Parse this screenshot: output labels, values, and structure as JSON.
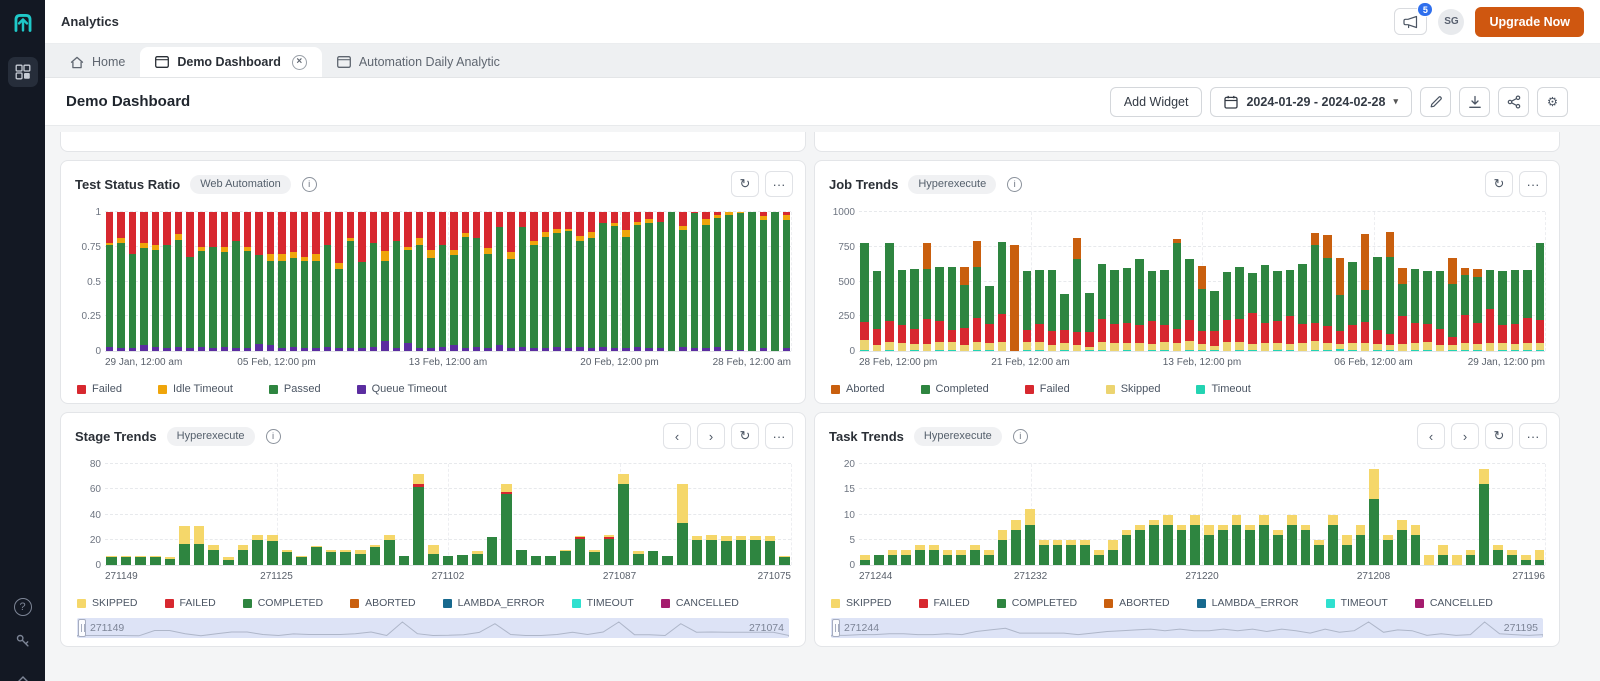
{
  "ui_colors": {
    "accent_orange": "#cf5710",
    "badge_blue": "#2f6fed",
    "sidebar_bg": "#131823",
    "logo_teal": "#1fc8c8",
    "card_border": "#e3e5e8",
    "brush_bg": "#dde3f6"
  },
  "icons": {
    "refresh": "↻",
    "more": "···",
    "prev": "‹",
    "next": "›",
    "caret_down": "▾",
    "close": "×",
    "gear": "⚙",
    "info": "i",
    "help": "?"
  },
  "topbar": {
    "title": "Analytics",
    "notification_count": "5",
    "avatar_initials": "SG",
    "upgrade_label": "Upgrade Now"
  },
  "tabs": [
    {
      "label": "Home"
    },
    {
      "label": "Demo Dashboard"
    },
    {
      "label": "Automation Daily Analytic"
    }
  ],
  "page_header": {
    "title": "Demo Dashboard",
    "add_widget_label": "Add Widget",
    "date_range": "2024-01-29 - 2024-02-28"
  },
  "chart_data": [
    {
      "type": "bar",
      "widget_title": "Test Status Ratio",
      "badge": "Web Automation",
      "ylim": [
        0,
        1
      ],
      "y_ticks": [
        0,
        0.25,
        0.5,
        0.75,
        1
      ],
      "x_ticks": [
        "29 Jan, 12:00 am",
        "05 Feb, 12:00 pm",
        "13 Feb, 12:00 am",
        "20 Feb, 12:00 pm",
        "28 Feb, 12:00 am"
      ],
      "stack": [
        "Queue Timeout",
        "Passed",
        "Idle Timeout",
        "Failed"
      ],
      "series": [
        {
          "name": "Failed",
          "color": "#d7282f",
          "values": [
            0.22,
            0.19,
            0.3,
            0.22,
            0.24,
            0.24,
            0.16,
            0.32,
            0.25,
            0.25,
            0.25,
            0.21,
            0.25,
            0.31,
            0.3,
            0.3,
            0.29,
            0.32,
            0.3,
            0.24,
            0.37,
            0.19,
            0.36,
            0.22,
            0.28,
            0.21,
            0.25,
            0.19,
            0.27,
            0.24,
            0.27,
            0.15,
            0.19,
            0.26,
            0.11,
            0.29,
            0.11,
            0.21,
            0.14,
            0.12,
            0.12,
            0.17,
            0.14,
            0.08,
            0.08,
            0.13,
            0.07,
            0.05,
            0.07,
            0,
            0.1,
            0.01,
            0.05,
            0.02,
            0,
            0,
            0,
            0.03,
            0,
            0.02
          ]
        },
        {
          "name": "Idle Timeout",
          "color": "#efa50b",
          "values": [
            0.02,
            0.03,
            0,
            0.04,
            0.03,
            0,
            0.04,
            0,
            0.03,
            0,
            0.04,
            0,
            0.03,
            0,
            0.05,
            0.05,
            0.04,
            0.03,
            0.05,
            0,
            0.04,
            0.02,
            0,
            0,
            0.07,
            0,
            0.02,
            0.05,
            0.06,
            0,
            0.04,
            0.03,
            0,
            0.04,
            0,
            0.05,
            0,
            0.03,
            0.04,
            0.03,
            0.02,
            0.04,
            0.05,
            0,
            0.02,
            0.05,
            0.02,
            0.03,
            0,
            0,
            0.03,
            0,
            0.04,
            0.02,
            0.02,
            0.01,
            0,
            0.03,
            0,
            0.04
          ]
        },
        {
          "name": "Passed",
          "color": "#2e8540",
          "values": [
            0.73,
            0.76,
            0.68,
            0.7,
            0.7,
            0.74,
            0.77,
            0.66,
            0.69,
            0.73,
            0.68,
            0.77,
            0.7,
            0.64,
            0.61,
            0.63,
            0.64,
            0.63,
            0.63,
            0.73,
            0.57,
            0.77,
            0.62,
            0.75,
            0.58,
            0.77,
            0.67,
            0.74,
            0.65,
            0.73,
            0.65,
            0.8,
            0.78,
            0.68,
            0.85,
            0.64,
            0.86,
            0.74,
            0.8,
            0.82,
            0.84,
            0.76,
            0.79,
            0.89,
            0.88,
            0.8,
            0.88,
            0.9,
            0.91,
            1.0,
            0.84,
            0.97,
            0.89,
            0.93,
            0.97,
            0.98,
            1.0,
            0.92,
            1.0,
            0.92
          ]
        },
        {
          "name": "Queue Timeout",
          "color": "#5b2da0",
          "values": [
            0.03,
            0.02,
            0.02,
            0.04,
            0.03,
            0.02,
            0.03,
            0.02,
            0.03,
            0.02,
            0.03,
            0.02,
            0.02,
            0.05,
            0.04,
            0.02,
            0.03,
            0.02,
            0.02,
            0.03,
            0.02,
            0.02,
            0.02,
            0.03,
            0.07,
            0.02,
            0.06,
            0.02,
            0.02,
            0.03,
            0.04,
            0.02,
            0.03,
            0.02,
            0.04,
            0.02,
            0.03,
            0.02,
            0.02,
            0.03,
            0.02,
            0.03,
            0.02,
            0.03,
            0.02,
            0.02,
            0.03,
            0.02,
            0.02,
            0,
            0.03,
            0.02,
            0.02,
            0.03,
            0.01,
            0.01,
            0,
            0.02,
            0,
            0.02
          ]
        }
      ]
    },
    {
      "type": "bar",
      "widget_title": "Job Trends",
      "badge": "Hyperexecute",
      "ylim": [
        0,
        1000
      ],
      "y_ticks": [
        0,
        250,
        500,
        750,
        1000
      ],
      "x_ticks": [
        "28 Feb, 12:00 pm",
        "21 Feb, 12:00 am",
        "13 Feb, 12:00 pm",
        "06 Feb, 12:00 am",
        "29 Jan, 12:00 pm"
      ],
      "stack": [
        "Timeout",
        "Skipped",
        "Failed",
        "Completed",
        "Aborted"
      ],
      "series": [
        {
          "name": "Aborted",
          "color": "#c95f0e",
          "values": [
            0,
            0,
            0,
            0,
            0,
            190,
            0,
            0,
            130,
            190,
            0,
            0,
            760,
            0,
            0,
            0,
            0,
            150,
            0,
            0,
            0,
            0,
            0,
            0,
            0,
            30,
            0,
            170,
            0,
            0,
            0,
            0,
            0,
            0,
            0,
            0,
            90,
            170,
            270,
            0,
            400,
            0,
            180,
            120,
            0,
            0,
            0,
            190,
            50,
            60,
            0,
            0,
            0,
            0,
            0
          ]
        },
        {
          "name": "Completed",
          "color": "#2e8540",
          "values": [
            570,
            420,
            560,
            400,
            430,
            360,
            390,
            450,
            310,
            370,
            270,
            520,
            0,
            420,
            390,
            440,
            260,
            520,
            280,
            400,
            390,
            390,
            470,
            360,
            400,
            620,
            440,
            300,
            290,
            340,
            370,
            290,
            420,
            360,
            330,
            430,
            560,
            490,
            260,
            450,
            230,
            520,
            560,
            230,
            390,
            380,
            420,
            380,
            290,
            330,
            280,
            390,
            390,
            340,
            560
          ]
        },
        {
          "name": "Failed",
          "color": "#d7282f",
          "values": [
            130,
            110,
            150,
            130,
            110,
            180,
            150,
            90,
            120,
            170,
            140,
            200,
            0,
            90,
            130,
            100,
            90,
            100,
            110,
            160,
            140,
            150,
            130,
            160,
            120,
            100,
            150,
            90,
            110,
            160,
            170,
            220,
            140,
            160,
            200,
            140,
            130,
            120,
            90,
            130,
            150,
            100,
            80,
            200,
            140,
            130,
            110,
            60,
            200,
            150,
            240,
            130,
            140,
            180,
            160
          ]
        },
        {
          "name": "Skipped",
          "color": "#ecd470",
          "values": [
            70,
            45,
            60,
            55,
            45,
            50,
            60,
            55,
            45,
            60,
            50,
            65,
            0,
            55,
            60,
            45,
            55,
            40,
            25,
            60,
            55,
            50,
            60,
            45,
            60,
            55,
            70,
            45,
            30,
            65,
            55,
            45,
            60,
            50,
            45,
            55,
            65,
            50,
            40,
            55,
            60,
            45,
            35,
            50,
            55,
            60,
            45,
            30,
            55,
            45,
            60,
            50,
            45,
            55,
            50
          ]
        },
        {
          "name": "Timeout",
          "color": "#23d3b2",
          "values": [
            6,
            0,
            8,
            0,
            5,
            0,
            6,
            8,
            0,
            5,
            8,
            0,
            0,
            8,
            5,
            0,
            5,
            0,
            5,
            8,
            0,
            5,
            0,
            8,
            5,
            0,
            5,
            8,
            5,
            0,
            8,
            5,
            0,
            5,
            8,
            0,
            5,
            8,
            12,
            5,
            0,
            8,
            5,
            0,
            5,
            8,
            0,
            10,
            5,
            8,
            0,
            5,
            8,
            5,
            10
          ]
        }
      ]
    },
    {
      "type": "bar",
      "widget_title": "Stage Trends",
      "badge": "Hyperexecute",
      "ylim": [
        0,
        80
      ],
      "y_ticks": [
        0,
        20,
        40,
        60,
        80
      ],
      "x_ticks": [
        "271149",
        "271125",
        "271102",
        "271087",
        "271075"
      ],
      "stack": [
        "COMPLETED",
        "FAILED",
        "SKIPPED"
      ],
      "brush": {
        "left": "271149",
        "right": "271074"
      },
      "series": [
        {
          "name": "SKIPPED",
          "color": "#f5d76a",
          "values": [
            1,
            1,
            1,
            1,
            1,
            14,
            14,
            4,
            2,
            4,
            4,
            5,
            2,
            1,
            1,
            2,
            2,
            3,
            2,
            4,
            0,
            8,
            7,
            0,
            0,
            2,
            0,
            6,
            0,
            0,
            0,
            1,
            1,
            2,
            2,
            8,
            2,
            0,
            0,
            31,
            3,
            4,
            4,
            3,
            3,
            4,
            1
          ]
        },
        {
          "name": "FAILED",
          "color": "#d7282f",
          "values": [
            0,
            0,
            0,
            0,
            0,
            0,
            0,
            0,
            0,
            0,
            0,
            0,
            0,
            0,
            0,
            0,
            0,
            0,
            0,
            0,
            0,
            2,
            0,
            0,
            0,
            0,
            0,
            2,
            0,
            0,
            0,
            0,
            1,
            0,
            1,
            0,
            0,
            0,
            0,
            0,
            0,
            0,
            0,
            0,
            0,
            0,
            0
          ]
        },
        {
          "name": "COMPLETED",
          "color": "#2e8540",
          "values": [
            6,
            6,
            6,
            6,
            5,
            17,
            17,
            12,
            4,
            12,
            20,
            19,
            10,
            6,
            14,
            10,
            10,
            9,
            14,
            20,
            7,
            62,
            9,
            7,
            8,
            9,
            22,
            56,
            12,
            7,
            7,
            11,
            21,
            10,
            21,
            64,
            9,
            11,
            7,
            33,
            20,
            20,
            19,
            20,
            20,
            19,
            6
          ]
        },
        {
          "name": "ABORTED",
          "color": "#c95f0e",
          "values": 0
        },
        {
          "name": "LAMBDA_ERROR",
          "color": "#17698e",
          "values": 0
        },
        {
          "name": "TIMEOUT",
          "color": "#2fe0cf",
          "values": 0
        },
        {
          "name": "CANCELLED",
          "color": "#a51c6e",
          "values": 0
        }
      ]
    },
    {
      "type": "bar",
      "widget_title": "Task Trends",
      "badge": "Hyperexecute",
      "ylim": [
        0,
        20
      ],
      "y_ticks": [
        0,
        5,
        10,
        15,
        20
      ],
      "x_ticks": [
        "271244",
        "271232",
        "271220",
        "271208",
        "271196"
      ],
      "stack": [
        "COMPLETED",
        "SKIPPED"
      ],
      "brush": {
        "left": "271244",
        "right": "271195"
      },
      "series": [
        {
          "name": "SKIPPED",
          "color": "#f5d76a",
          "values": [
            1,
            0,
            1,
            1,
            1,
            1,
            1,
            1,
            1,
            1,
            2,
            2,
            3,
            1,
            1,
            1,
            1,
            1,
            2,
            1,
            1,
            1,
            2,
            1,
            2,
            2,
            1,
            2,
            1,
            2,
            1,
            2,
            1,
            1,
            2,
            2,
            2,
            6,
            1,
            2,
            2,
            2,
            2,
            2,
            1,
            3,
            1,
            1,
            1,
            2
          ]
        },
        {
          "name": "FAILED",
          "color": "#d7282f",
          "values": 0
        },
        {
          "name": "COMPLETED",
          "color": "#2e8540",
          "values": [
            1,
            2,
            2,
            2,
            3,
            3,
            2,
            2,
            3,
            2,
            5,
            7,
            8,
            4,
            4,
            4,
            4,
            2,
            3,
            6,
            7,
            8,
            8,
            7,
            8,
            6,
            7,
            8,
            7,
            8,
            6,
            8,
            7,
            4,
            8,
            4,
            6,
            13,
            5,
            7,
            6,
            0,
            2,
            0,
            2,
            16,
            3,
            2,
            1,
            1
          ]
        },
        {
          "name": "ABORTED",
          "color": "#c95f0e",
          "values": 0
        },
        {
          "name": "LAMBDA_ERROR",
          "color": "#17698e",
          "values": 0
        },
        {
          "name": "TIMEOUT",
          "color": "#2fe0cf",
          "values": 0
        },
        {
          "name": "CANCELLED",
          "color": "#a51c6e",
          "values": 0
        }
      ]
    }
  ]
}
